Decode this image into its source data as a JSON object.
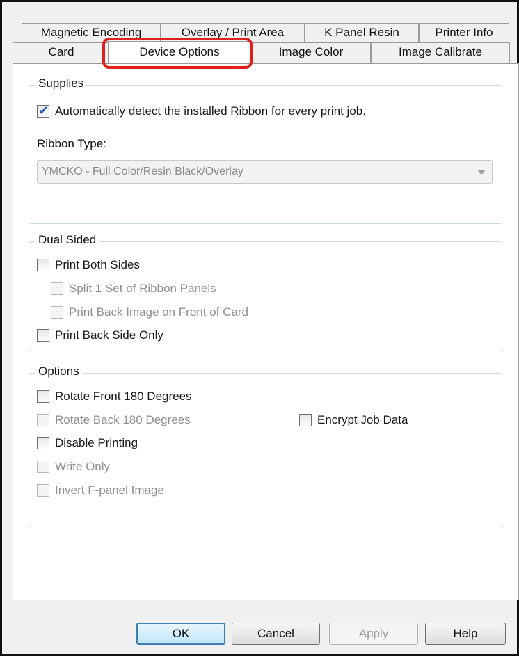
{
  "tabs": {
    "row_back": [
      "Magnetic Encoding",
      "Overlay / Print Area",
      "K Panel Resin",
      "Printer Info"
    ],
    "row_front": [
      "Card",
      "Device Options",
      "Image Color",
      "Image Calibrate"
    ],
    "selected": "Device Options",
    "highlight_color": "#e0201c"
  },
  "supplies": {
    "title": "Supplies",
    "auto_detect_label": "Automatically detect the installed Ribbon for every print job.",
    "auto_detect_checked": true,
    "ribbon_type_label": "Ribbon Type:",
    "ribbon_type_value": "YMCKO - Full Color/Resin Black/Overlay"
  },
  "dual_sided": {
    "title": "Dual Sided",
    "print_both_sides": "Print Both Sides",
    "split_ribbon": "Split 1 Set of Ribbon Panels",
    "print_back_on_front": "Print Back Image on Front of Card",
    "print_back_only": "Print Back Side Only"
  },
  "options": {
    "title": "Options",
    "rotate_front": "Rotate Front 180 Degrees",
    "rotate_back": "Rotate Back 180 Degrees",
    "encrypt_job": "Encrypt Job Data",
    "disable_printing": "Disable Printing",
    "write_only": "Write Only",
    "invert_f_panel": "Invert F-panel Image"
  },
  "buttons": {
    "ok": "OK",
    "cancel": "Cancel",
    "apply": "Apply",
    "help": "Help"
  }
}
